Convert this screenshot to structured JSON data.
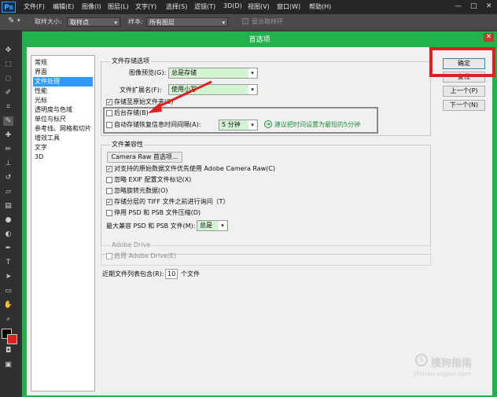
{
  "menubar": {
    "logo": "Ps",
    "items": [
      "文件(F)",
      "编辑(E)",
      "图像(I)",
      "图层(L)",
      "文字(Y)",
      "选择(S)",
      "滤镜(T)",
      "3D(D)",
      "视图(V)",
      "窗口(W)",
      "帮助(H)"
    ],
    "window_controls": [
      "—",
      "□",
      "✕"
    ]
  },
  "optionsbar": {
    "sample_size_label": "取样大小:",
    "sample_size_value": "取样点",
    "sample_label": "样本:",
    "sample_value": "所有图层",
    "show_ring_label": "显示取样环"
  },
  "dialog": {
    "title": "首选项",
    "close": "✕",
    "categories": [
      "常规",
      "界面",
      "文件处理",
      "性能",
      "光标",
      "透明度与色域",
      "单位与标尺",
      "参考线、网格和切片",
      "增效工具",
      "文字",
      "3D"
    ],
    "selected_category": "文件处理",
    "file_saving": {
      "legend": "文件存储选项",
      "image_preview_label": "图像预览(G):",
      "image_preview_value": "总是存储",
      "extension_label": "文件扩展名(F):",
      "extension_value": "使用小写",
      "save_original_label": "存储至原始文件夹(S)",
      "save_original_checked": true,
      "background_save_label": "后台存储(B)",
      "background_save_checked": false,
      "autosave_label": "自动存储恢复信息时间间隔(A):",
      "autosave_checked": false,
      "autosave_interval": "5 分钟",
      "hint": "建议把时间设置为最短的5分钟"
    },
    "compat": {
      "legend": "文件兼容性",
      "camera_raw_button": "Camera Raw 首选项...",
      "options": [
        {
          "label": "对支持的原始数据文件优先使用 Adobe Camera Raw(C)",
          "checked": true
        },
        {
          "label": "忽略 EXIF 配置文件标记(X)",
          "checked": false
        },
        {
          "label": "忽略旋转元数据(O)",
          "checked": false
        },
        {
          "label": "存储分层的 TIFF 文件之前进行询问（T）",
          "checked": true
        },
        {
          "label": "停用 PSD 和 PSB 文件压缩(D)",
          "checked": false
        }
      ],
      "max_compat_label": "最大兼容 PSD 和 PSB 文件(M):",
      "max_compat_value": "总是"
    },
    "adobe_drive": {
      "legend": "Adobe Drive",
      "enable_label": "启用 Adobe Drive(E)",
      "enable_checked": false
    },
    "recent_files": {
      "label": "近期文件列表包含(R):",
      "value": "10",
      "suffix": "个文件"
    },
    "buttons": {
      "ok": "确定",
      "reset": "复位",
      "prev": "上一个(P)",
      "next": "下一个(N)"
    }
  },
  "watermark": {
    "main": "搜狗指南",
    "url": "zhinan.sogou.com"
  },
  "colors": {
    "accent_green": "#22b14c",
    "highlight_red": "#e02020",
    "hint_green": "#1e8f3a",
    "selection_blue": "#3399ff"
  }
}
